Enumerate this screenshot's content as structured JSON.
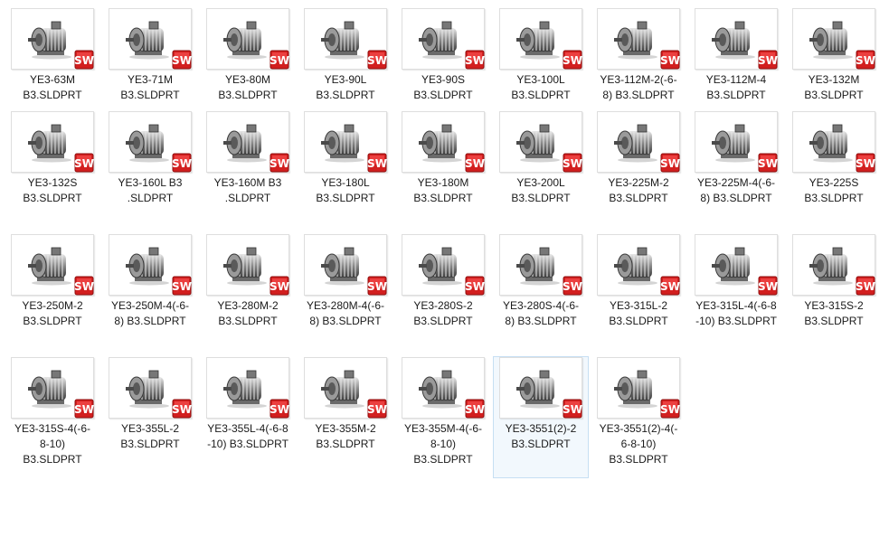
{
  "files": [
    {
      "name": "YE3-63M\nB3.SLDPRT",
      "selected": false
    },
    {
      "name": "YE3-71M\nB3.SLDPRT",
      "selected": false
    },
    {
      "name": "YE3-80M\nB3.SLDPRT",
      "selected": false
    },
    {
      "name": "YE3-90L\nB3.SLDPRT",
      "selected": false
    },
    {
      "name": "YE3-90S\nB3.SLDPRT",
      "selected": false
    },
    {
      "name": "YE3-100L\nB3.SLDPRT",
      "selected": false
    },
    {
      "name": "YE3-112M-2(-6-\n8) B3.SLDPRT",
      "selected": false
    },
    {
      "name": "YE3-112M-4\nB3.SLDPRT",
      "selected": false
    },
    {
      "name": "YE3-132M\nB3.SLDPRT",
      "selected": false
    },
    {
      "name": "YE3-132S\nB3.SLDPRT",
      "selected": false
    },
    {
      "name": "YE3-160L B3\n.SLDPRT",
      "selected": false
    },
    {
      "name": "YE3-160M B3\n.SLDPRT",
      "selected": false
    },
    {
      "name": "YE3-180L\nB3.SLDPRT",
      "selected": false
    },
    {
      "name": "YE3-180M\nB3.SLDPRT",
      "selected": false
    },
    {
      "name": "YE3-200L\nB3.SLDPRT",
      "selected": false
    },
    {
      "name": "YE3-225M-2\nB3.SLDPRT",
      "selected": false
    },
    {
      "name": "YE3-225M-4(-6-\n8) B3.SLDPRT",
      "selected": false
    },
    {
      "name": "YE3-225S\nB3.SLDPRT",
      "selected": false
    },
    {
      "name": "YE3-250M-2\nB3.SLDPRT",
      "selected": false
    },
    {
      "name": "YE3-250M-4(-6-\n8) B3.SLDPRT",
      "selected": false
    },
    {
      "name": "YE3-280M-2\nB3.SLDPRT",
      "selected": false
    },
    {
      "name": "YE3-280M-4(-6-\n8) B3.SLDPRT",
      "selected": false
    },
    {
      "name": "YE3-280S-2\nB3.SLDPRT",
      "selected": false
    },
    {
      "name": "YE3-280S-4(-6-\n8) B3.SLDPRT",
      "selected": false
    },
    {
      "name": "YE3-315L-2\nB3.SLDPRT",
      "selected": false
    },
    {
      "name": "YE3-315L-4(-6-8\n-10) B3.SLDPRT",
      "selected": false
    },
    {
      "name": "YE3-315S-2\nB3.SLDPRT",
      "selected": false
    },
    {
      "name": "YE3-315S-4(-6-\n8-10)\nB3.SLDPRT",
      "selected": false
    },
    {
      "name": "YE3-355L-2\nB3.SLDPRT",
      "selected": false
    },
    {
      "name": "YE3-355L-4(-6-8\n-10) B3.SLDPRT",
      "selected": false
    },
    {
      "name": "YE3-355M-2\nB3.SLDPRT",
      "selected": false
    },
    {
      "name": "YE3-355M-4(-6-\n8-10)\nB3.SLDPRT",
      "selected": false
    },
    {
      "name": "YE3-3551(2)-2\nB3.SLDPRT",
      "selected": true
    },
    {
      "name": "YE3-3551(2)-4(-\n6-8-10)\nB3.SLDPRT",
      "selected": false
    }
  ],
  "icons": {
    "thumbnail": "motor-part-icon",
    "badge": "solidworks-badge-icon"
  },
  "colors": {
    "badge_red": "#d21f1f",
    "selection_fill": "#f2f8fd",
    "selection_border": "#c6dff3"
  }
}
